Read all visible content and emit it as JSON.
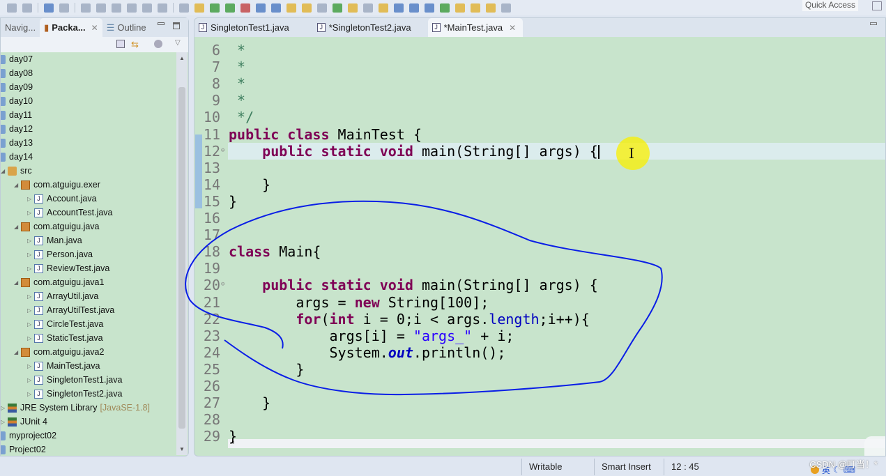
{
  "toolbar": {
    "quick_access": "Quick Access"
  },
  "left_panel": {
    "tabs": [
      {
        "label": "Navig..."
      },
      {
        "label": "Packa...",
        "active": true
      },
      {
        "label": "Outline"
      }
    ],
    "tree": [
      {
        "label": "day07",
        "level": 0,
        "icon": "project-folder-icon"
      },
      {
        "label": "day08",
        "level": 0,
        "icon": "project-folder-icon"
      },
      {
        "label": "day09",
        "level": 0,
        "icon": "project-folder-icon"
      },
      {
        "label": "day10",
        "level": 0,
        "icon": "project-folder-icon"
      },
      {
        "label": "day11",
        "level": 0,
        "icon": "project-folder-icon"
      },
      {
        "label": "day12",
        "level": 0,
        "icon": "project-folder-icon"
      },
      {
        "label": "day13",
        "level": 0,
        "icon": "project-folder-icon"
      },
      {
        "label": "day14",
        "level": 0,
        "icon": "project-folder-icon"
      },
      {
        "label": "src",
        "level": 1,
        "icon": "source-folder-icon",
        "expanded": true
      },
      {
        "label": "com.atguigu.exer",
        "level": 2,
        "icon": "package-icon",
        "expanded": true
      },
      {
        "label": "Account.java",
        "level": 3,
        "icon": "java-file-icon"
      },
      {
        "label": "AccountTest.java",
        "level": 3,
        "icon": "java-file-icon"
      },
      {
        "label": "com.atguigu.java",
        "level": 2,
        "icon": "package-icon",
        "expanded": true
      },
      {
        "label": "Man.java",
        "level": 3,
        "icon": "java-file-icon"
      },
      {
        "label": "Person.java",
        "level": 3,
        "icon": "java-file-icon"
      },
      {
        "label": "ReviewTest.java",
        "level": 3,
        "icon": "java-file-icon"
      },
      {
        "label": "com.atguigu.java1",
        "level": 2,
        "icon": "package-icon",
        "expanded": true
      },
      {
        "label": "ArrayUtil.java",
        "level": 3,
        "icon": "java-file-icon"
      },
      {
        "label": "ArrayUtilTest.java",
        "level": 3,
        "icon": "java-file-icon"
      },
      {
        "label": "CircleTest.java",
        "level": 3,
        "icon": "java-file-icon"
      },
      {
        "label": "StaticTest.java",
        "level": 3,
        "icon": "java-file-icon"
      },
      {
        "label": "com.atguigu.java2",
        "level": 2,
        "icon": "package-icon",
        "expanded": true
      },
      {
        "label": "MainTest.java",
        "level": 3,
        "icon": "java-file-icon"
      },
      {
        "label": "SingletonTest1.java",
        "level": 3,
        "icon": "java-file-icon"
      },
      {
        "label": "SingletonTest2.java",
        "level": 3,
        "icon": "java-file-icon"
      },
      {
        "label": "JRE System Library",
        "decoration": "[JavaSE-1.8]",
        "level": 1,
        "icon": "library-icon"
      },
      {
        "label": "JUnit 4",
        "level": 1,
        "icon": "library-icon"
      },
      {
        "label": "myproject02",
        "level": 0,
        "icon": "project-folder-icon"
      },
      {
        "label": "Project02",
        "level": 0,
        "icon": "project-folder-icon"
      }
    ]
  },
  "editor": {
    "tabs": [
      {
        "label": "SingletonTest1.java"
      },
      {
        "label": "*SingletonTest2.java"
      },
      {
        "label": "*MainTest.java",
        "active": true
      }
    ],
    "current_line": 12,
    "lines": [
      {
        "n": 6,
        "t": [
          [
            " *",
            "cm"
          ]
        ]
      },
      {
        "n": 7,
        "t": [
          [
            " *",
            "cm"
          ]
        ]
      },
      {
        "n": 8,
        "t": [
          [
            " *",
            "cm"
          ]
        ]
      },
      {
        "n": 9,
        "t": [
          [
            " *",
            "cm"
          ]
        ]
      },
      {
        "n": 10,
        "t": [
          [
            " */",
            "cm"
          ]
        ]
      },
      {
        "n": 11,
        "t": [
          [
            "public",
            "kw"
          ],
          [
            " "
          ],
          [
            "class",
            "kw"
          ],
          [
            " MainTest {"
          ]
        ]
      },
      {
        "n": 12,
        "fold": true,
        "caret": true,
        "t": [
          [
            "    "
          ],
          [
            "public",
            "kw"
          ],
          [
            " "
          ],
          [
            "static",
            "kw"
          ],
          [
            " "
          ],
          [
            "void",
            "kw"
          ],
          [
            " main(String[] args) {"
          ]
        ]
      },
      {
        "n": 13,
        "t": []
      },
      {
        "n": 14,
        "t": [
          [
            "    }"
          ]
        ]
      },
      {
        "n": 15,
        "t": [
          [
            "}"
          ]
        ]
      },
      {
        "n": 16,
        "t": []
      },
      {
        "n": 17,
        "t": []
      },
      {
        "n": 18,
        "t": [
          [
            "class",
            "kw"
          ],
          [
            " Main{"
          ]
        ]
      },
      {
        "n": 19,
        "t": []
      },
      {
        "n": 20,
        "fold": true,
        "t": [
          [
            "    "
          ],
          [
            "public",
            "kw"
          ],
          [
            " "
          ],
          [
            "static",
            "kw"
          ],
          [
            " "
          ],
          [
            "void",
            "kw"
          ],
          [
            " main(String[] args) {"
          ]
        ]
      },
      {
        "n": 21,
        "t": [
          [
            "        args = "
          ],
          [
            "new",
            "kw"
          ],
          [
            " String[100];"
          ]
        ]
      },
      {
        "n": 22,
        "t": [
          [
            "        "
          ],
          [
            "for",
            "kw"
          ],
          [
            "("
          ],
          [
            "int",
            "kw"
          ],
          [
            " i = 0;i < args."
          ],
          [
            "length",
            "fld"
          ],
          [
            ";i++){"
          ]
        ]
      },
      {
        "n": 23,
        "t": [
          [
            "            args[i] = "
          ],
          [
            "\"args_\"",
            "str"
          ],
          [
            " + i;"
          ]
        ]
      },
      {
        "n": 24,
        "t": [
          [
            "            System."
          ],
          [
            "out",
            "sfld"
          ],
          [
            ".println();"
          ]
        ]
      },
      {
        "n": 25,
        "t": [
          [
            "        }"
          ]
        ]
      },
      {
        "n": 26,
        "t": []
      },
      {
        "n": 27,
        "t": [
          [
            "    }"
          ]
        ]
      },
      {
        "n": 28,
        "t": []
      },
      {
        "n": 29,
        "t": [
          [
            "}"
          ]
        ]
      }
    ]
  },
  "status": {
    "writable": "Writable",
    "insert_mode": "Smart Insert",
    "position": "12 : 45"
  },
  "watermark": "CSDN @叮当！*",
  "ime": {
    "label": "英"
  },
  "colors": {
    "editor_bg": "#c8e4cc",
    "annotation_pen": "#0a1ee6",
    "highlight": "#f5eb00"
  }
}
